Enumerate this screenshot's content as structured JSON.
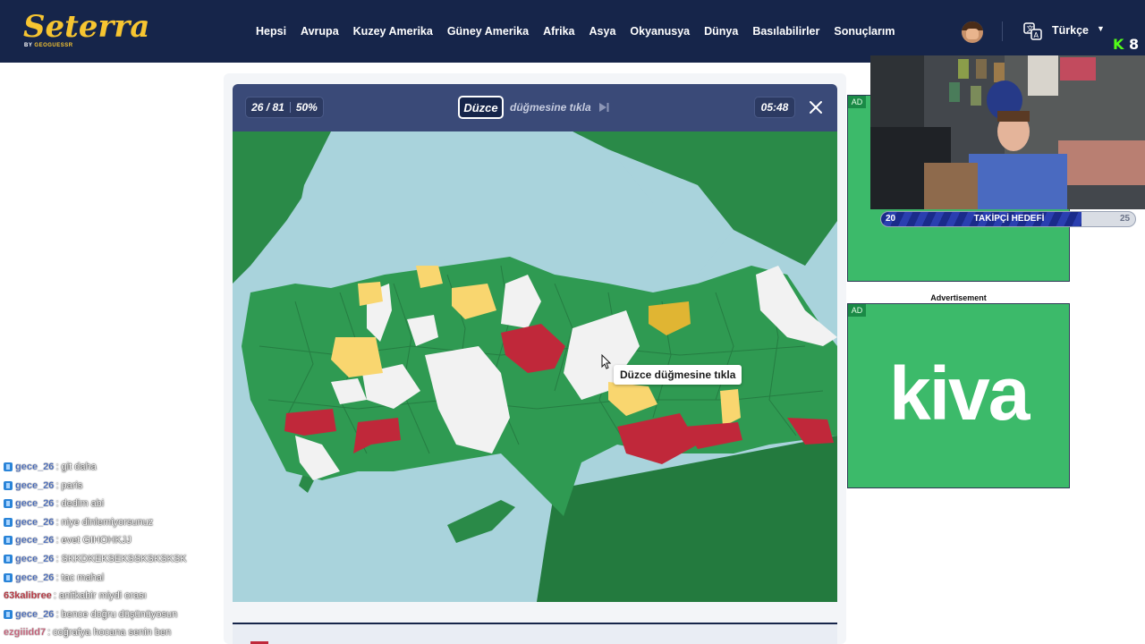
{
  "app": {
    "logo_text": "Seterra",
    "logo_sub_prefix": "BY ",
    "logo_sub_brand": "GEOGUESSR"
  },
  "nav": {
    "items": [
      "Hepsi",
      "Avrupa",
      "Kuzey Amerika",
      "Güney Amerika",
      "Afrika",
      "Asya",
      "Okyanusya",
      "Dünya",
      "Basılabilirler",
      "Sonuçlarım"
    ],
    "language": "Türkçe"
  },
  "stream": {
    "platform_logo": "K"
  },
  "quiz": {
    "progress": "26 / 81",
    "percent": "50%",
    "target": "Düzce",
    "prompt": "düğmesine tıkla",
    "timer": "05:48",
    "tooltip": "Düzce düğmesine tıkla"
  },
  "colors": {
    "nav_bg": "#16254a",
    "logo": "#f7c531",
    "sea": "#a9d3dc",
    "land_outside": "#2a8a48",
    "province_correct": "#2f9a52",
    "province_unanswered": "#f2f2f2",
    "province_wrong": "#c0283a",
    "province_hint_light": "#f9d66f",
    "province_hint_dark": "#e0b533",
    "ad_green": "#3cba6a"
  },
  "ads": {
    "badge": "AD",
    "label": "Advertisement",
    "brand": "kiva"
  },
  "follower_goal": {
    "start": "20",
    "title": "TAKİPÇİ HEDEFİ",
    "end": "25",
    "progress": 0.79
  },
  "chat": {
    "messages": [
      {
        "user": "gece_26",
        "text": ": git daha",
        "color": "blue"
      },
      {
        "user": "gece_26",
        "text": ": paris",
        "color": "blue"
      },
      {
        "user": "gece_26",
        "text": ": dedim abi",
        "color": "blue"
      },
      {
        "user": "gece_26",
        "text": ": niye dinlemiyorsunuz",
        "color": "blue"
      },
      {
        "user": "gece_26",
        "text": ": evet GIHOHKJJ",
        "color": "blue"
      },
      {
        "user": "gece_26",
        "text": ": SKKDKEKSEKSSKSKSKSK",
        "color": "blue"
      },
      {
        "user": "gece_26",
        "text": ": tac mahal",
        "color": "blue"
      },
      {
        "user": "63kalibree",
        "text": ": anitkabir miydi orası",
        "color": "red"
      },
      {
        "user": "gece_26",
        "text": ": bence doğru düşünüyosun",
        "color": "blue"
      },
      {
        "user": "ezgiiidd7",
        "text": ": coğrafya hocana senin ben",
        "color": "pink"
      }
    ]
  }
}
